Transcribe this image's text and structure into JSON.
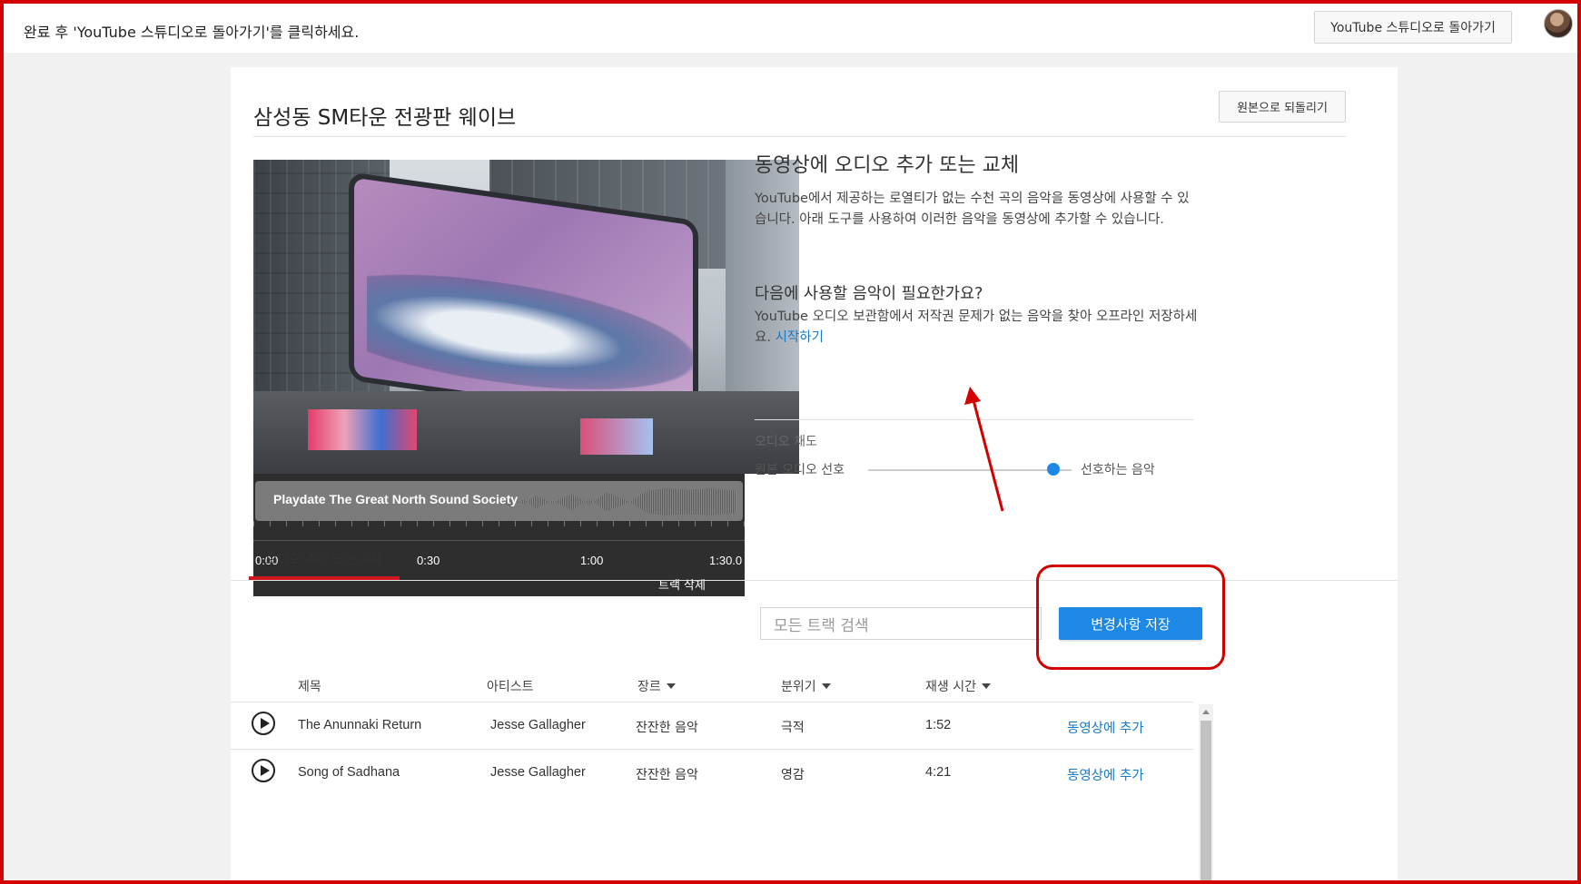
{
  "topbar": {
    "message": "완료 후 'YouTube 스튜디오로 돌아가기'를 클릭하세요.",
    "back_button": "YouTube 스튜디오로 돌아가기"
  },
  "page": {
    "title": "삼성동 SM타운 전광판 웨이브",
    "revert_button": "원본으로 되돌리기"
  },
  "track": {
    "name": "Playdate The Great North Sound Society",
    "ticks": [
      "0:00",
      "0:30",
      "1:00",
      "1:30.0"
    ],
    "delete_label": "트랙 삭제"
  },
  "info": {
    "title": "동영상에 오디오 추가 또는 교체",
    "description": "YouTube에서 제공하는 로열티가 없는 수천 곡의 음악을 동영상에 사용할 수 있습니다. 아래 도구를 사용하여 이러한 음악을 동영상에 추가할 수 있습니다.",
    "need_title": "다음에 사용할 음악이 필요한가요?",
    "need_description": "YouTube 오디오 보관함에서 저작권 문제가 없는 음악을 찾아 오프라인 저장하세요.",
    "need_link": "시작하기"
  },
  "channel": {
    "label": "오디오 채도",
    "left_label": "원본 오디오 선호",
    "right_label": "선호하는 음악",
    "slider_value": 0.9
  },
  "tabs": [
    {
      "label": "오디오 추가 또는 교체",
      "active": true
    }
  ],
  "search": {
    "placeholder": "모든 트랙 검색"
  },
  "save_button": "변경사항 저장",
  "table": {
    "headers": {
      "title": "제목",
      "artist": "아티스트",
      "genre": "장르",
      "mood": "분위기",
      "duration": "재생 시간"
    },
    "rows": [
      {
        "title": "The Anunnaki Return",
        "artist": "Jesse Gallagher",
        "genre": "잔잔한 음악",
        "mood": "극적",
        "duration": "1:52",
        "action": "동영상에 추가"
      },
      {
        "title": "Song of Sadhana",
        "artist": "Jesse Gallagher",
        "genre": "잔잔한 음악",
        "mood": "영감",
        "duration": "4:21",
        "action": "동영상에 추가"
      }
    ]
  },
  "colors": {
    "accent": "#1e88e5",
    "link": "#167ac6",
    "annotation": "#d40000",
    "tab_active": "#cc181e"
  }
}
